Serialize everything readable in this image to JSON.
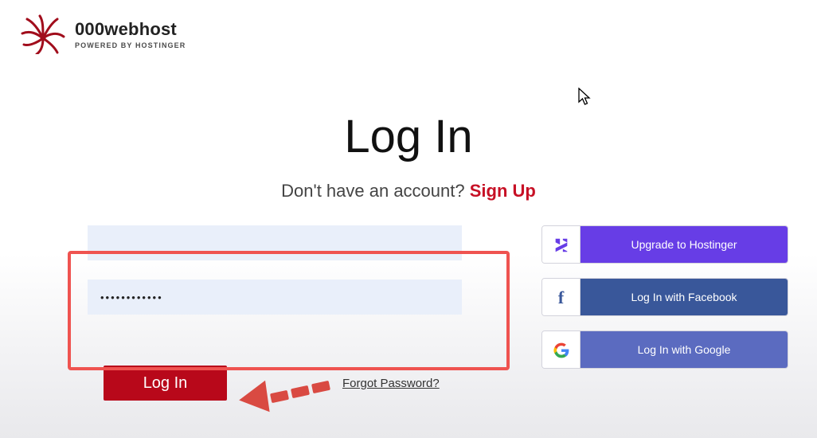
{
  "header": {
    "brand": "000webhost",
    "tagline": "POWERED BY HOSTINGER"
  },
  "title": "Log In",
  "subtitle": {
    "prompt": "Don't have an account? ",
    "link": "Sign Up"
  },
  "form": {
    "email_value": "",
    "password_value": "••••••••••••",
    "login_label": "Log In",
    "forgot_label": "Forgot Password?"
  },
  "social": {
    "hostinger": "Upgrade to Hostinger",
    "facebook": "Log In with Facebook",
    "google": "Log In with Google"
  },
  "icons": {
    "hostinger_glyph": "H",
    "facebook_glyph": "f"
  },
  "colors": {
    "accent_red": "#c71025",
    "button_red": "#b8081a",
    "hostinger_purple": "#673de6",
    "facebook_blue": "#39579a",
    "google_blue": "#5b6bc0"
  }
}
